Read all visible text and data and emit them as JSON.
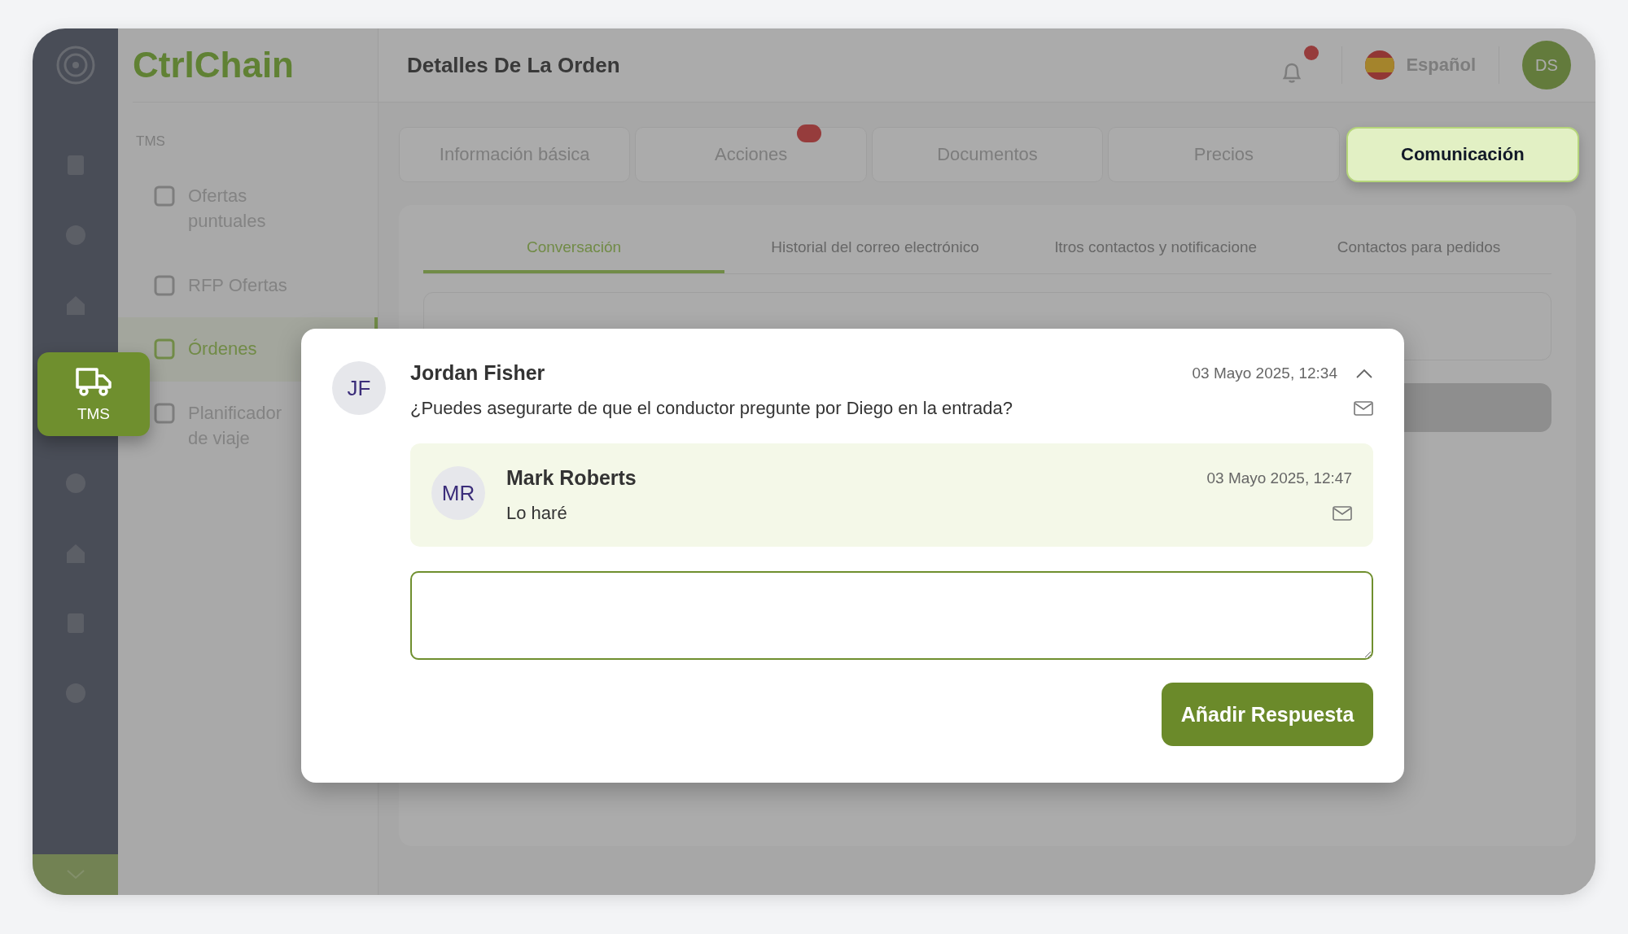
{
  "rail": {
    "items": [
      {
        "selected": false
      },
      {
        "selected": false
      },
      {
        "selected": false
      },
      {
        "label": "TMS",
        "selected": true
      },
      {
        "selected": false
      },
      {
        "selected": false
      },
      {
        "selected": false
      },
      {
        "selected": false
      }
    ]
  },
  "sidebar": {
    "brand": "CtrlChain",
    "section": "TMS",
    "items": [
      {
        "label": "Ofertas puntuales",
        "selected": false
      },
      {
        "label": "RFP Ofertas",
        "selected": false
      },
      {
        "label": "Órdenes",
        "selected": true
      },
      {
        "label": "Planificador de viaje",
        "selected": false
      }
    ]
  },
  "header": {
    "title": "Detalles De La Orden",
    "notifications": true,
    "language": "Español",
    "user_initials": "DS"
  },
  "tabs": [
    {
      "label": "Información básica",
      "selected": false,
      "badge": false
    },
    {
      "label": "Acciones",
      "selected": false,
      "badge": true
    },
    {
      "label": "Documentos",
      "selected": false,
      "badge": false
    },
    {
      "label": "Precios",
      "selected": false,
      "badge": false
    },
    {
      "label": "Comunicación",
      "selected": true,
      "badge": false
    }
  ],
  "subtabs": [
    {
      "label": "Conversación",
      "selected": true
    },
    {
      "label": "Historial del correo electrónico",
      "selected": false
    },
    {
      "label": "ltros contactos y notificacione",
      "selected": false
    },
    {
      "label": "Contactos para pedidos",
      "selected": false
    }
  ],
  "thread": {
    "initials": "JF",
    "author": "Jordan Fisher",
    "time": "03 Mayo 2025, 12:34",
    "text": "¿Puedes asegurarte de que el conductor pregunte por Diego en la entrada?",
    "expanded": true,
    "replies": [
      {
        "initials": "MR",
        "author": "Mark Roberts",
        "time": "03 Mayo 2025, 12:47",
        "text": "Lo haré"
      }
    ]
  },
  "reply_button": "Añadir Respuesta"
}
